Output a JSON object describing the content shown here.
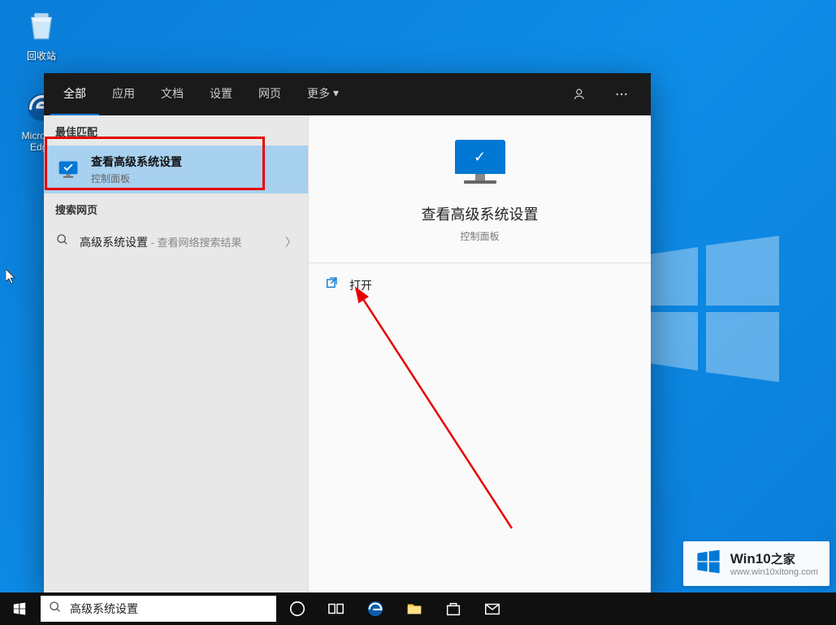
{
  "desktop": {
    "recycle_bin": "回收站",
    "edge": "Microsoft Edge"
  },
  "search": {
    "tabs": [
      "全部",
      "应用",
      "文档",
      "设置",
      "网页"
    ],
    "more": "更多",
    "best_match": "最佳匹配",
    "result": {
      "title": "查看高级系统设置",
      "subtitle": "控制面板"
    },
    "web_header": "搜索网页",
    "web_item": {
      "query": "高级系统设置",
      "suffix": " - 查看网络搜索结果"
    },
    "preview": {
      "title": "查看高级系统设置",
      "subtitle": "控制面板"
    },
    "action_open": "打开",
    "input_value": "高级系统设置"
  },
  "watermark": {
    "title_en": "Win10",
    "title_zh": "之家",
    "url": "www.win10xitong.com"
  }
}
